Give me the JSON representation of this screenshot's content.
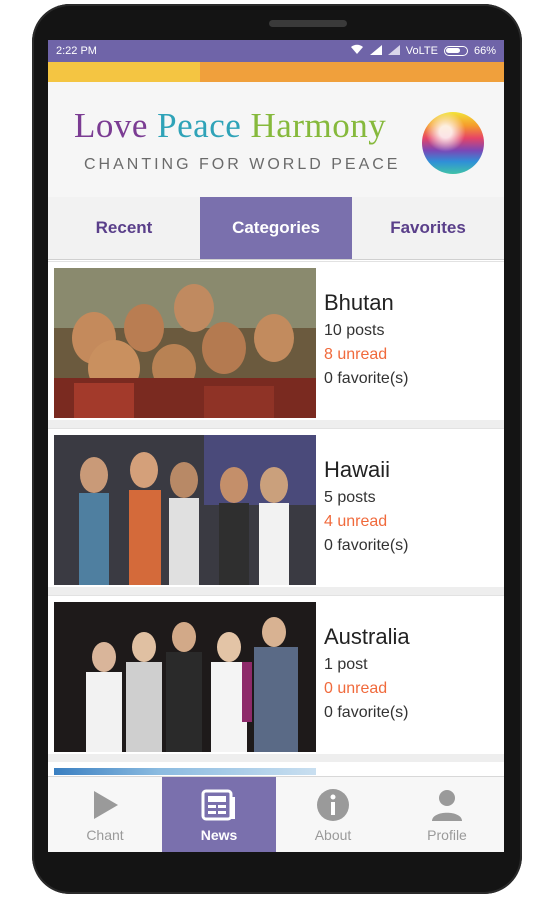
{
  "status": {
    "time": "2:22 PM",
    "network": "VoLTE",
    "battery": "66%"
  },
  "header": {
    "title_part1": "Love",
    "title_part2": "Peace",
    "title_part3": "Harmony",
    "subtitle": "CHANTING FOR WORLD PEACE"
  },
  "tabs": [
    {
      "label": "Recent"
    },
    {
      "label": "Categories"
    },
    {
      "label": "Favorites"
    }
  ],
  "categories": [
    {
      "name": "Bhutan",
      "posts": "10 posts",
      "unread": "8 unread",
      "favorites": "0 favorite(s)"
    },
    {
      "name": "Hawaii",
      "posts": "5 posts",
      "unread": "4 unread",
      "favorites": "0 favorite(s)"
    },
    {
      "name": "Australia",
      "posts": "1 post",
      "unread": "0 unread",
      "favorites": "0 favorite(s)"
    }
  ],
  "nav": [
    {
      "label": "Chant",
      "icon": "play-icon"
    },
    {
      "label": "News",
      "icon": "newspaper-icon"
    },
    {
      "label": "About",
      "icon": "info-icon"
    },
    {
      "label": "Profile",
      "icon": "person-icon"
    }
  ],
  "colors": {
    "accent": "#7a70ad",
    "unread": "#f06a3c",
    "statusbar": "#6f64a8"
  }
}
